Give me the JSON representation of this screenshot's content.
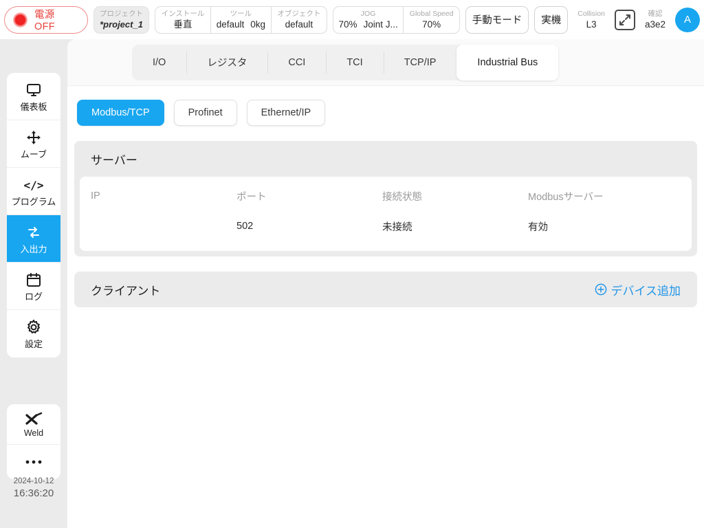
{
  "topbar": {
    "power": {
      "label": "電源OFF",
      "icon": "power-indicator-icon"
    },
    "project": {
      "caption": "プロジェクト",
      "value": "*project_1"
    },
    "install": {
      "caption": "インストール",
      "value": "垂直"
    },
    "tool": {
      "caption": "ツール",
      "value": "default",
      "payload": "0kg"
    },
    "object": {
      "caption": "オブジェクト",
      "value": "default"
    },
    "jog": {
      "caption": "JOG",
      "percent": "70%",
      "mode": "Joint J..."
    },
    "global_speed": {
      "caption": "Global Speed",
      "value": "70%"
    },
    "mode_button": "手動モード",
    "machine_button": "実機",
    "collision": {
      "caption": "Collision",
      "value": "L3"
    },
    "confirm": {
      "caption": "確認",
      "value": "a3e2"
    },
    "expand_icon": "expand-icon",
    "avatar": "A"
  },
  "sidebar": {
    "items": [
      {
        "label": "儀表板",
        "icon": "monitor-icon",
        "active": false
      },
      {
        "label": "ムーブ",
        "icon": "move-arrows-icon",
        "active": false
      },
      {
        "label": "プログラム",
        "icon": "code-icon",
        "active": false
      },
      {
        "label": "入出力",
        "icon": "io-sync-icon",
        "active": true
      },
      {
        "label": "ログ",
        "icon": "calendar-icon",
        "active": false
      },
      {
        "label": "設定",
        "icon": "gear-icon",
        "active": false
      }
    ],
    "tools": [
      {
        "label": "Weld",
        "icon": "weld-torch-icon"
      },
      {
        "label": "",
        "icon": "more-dots-icon"
      }
    ],
    "clock": {
      "date": "2024-10-12",
      "time": "16:36:20"
    }
  },
  "main": {
    "tabs": [
      {
        "label": "I/O",
        "active": false
      },
      {
        "label": "レジスタ",
        "active": false
      },
      {
        "label": "CCI",
        "active": false
      },
      {
        "label": "TCI",
        "active": false
      },
      {
        "label": "TCP/IP",
        "active": false
      },
      {
        "label": "Industrial Bus",
        "active": true
      }
    ],
    "subtabs": [
      {
        "label": "Modbus/TCP",
        "active": true
      },
      {
        "label": "Profinet",
        "active": false
      },
      {
        "label": "Ethernet/IP",
        "active": false
      }
    ],
    "server": {
      "title": "サーバー",
      "columns": [
        "IP",
        "ポート",
        "接続状態",
        "Modbusサーバー"
      ],
      "rows": [
        {
          "ip": "",
          "port": "502",
          "connection": "未接続",
          "modbus_server": "有効"
        }
      ]
    },
    "client": {
      "title": "クライアント",
      "add_device_label": "デバイス追加",
      "add_device_icon": "plus-circle-icon",
      "rows": []
    }
  },
  "colors": {
    "accent": "#18a6f0",
    "link": "#2196e8",
    "power_red": "#e8403a",
    "page_bg": "#ebebeb",
    "panel_bg": "#ffffff"
  }
}
